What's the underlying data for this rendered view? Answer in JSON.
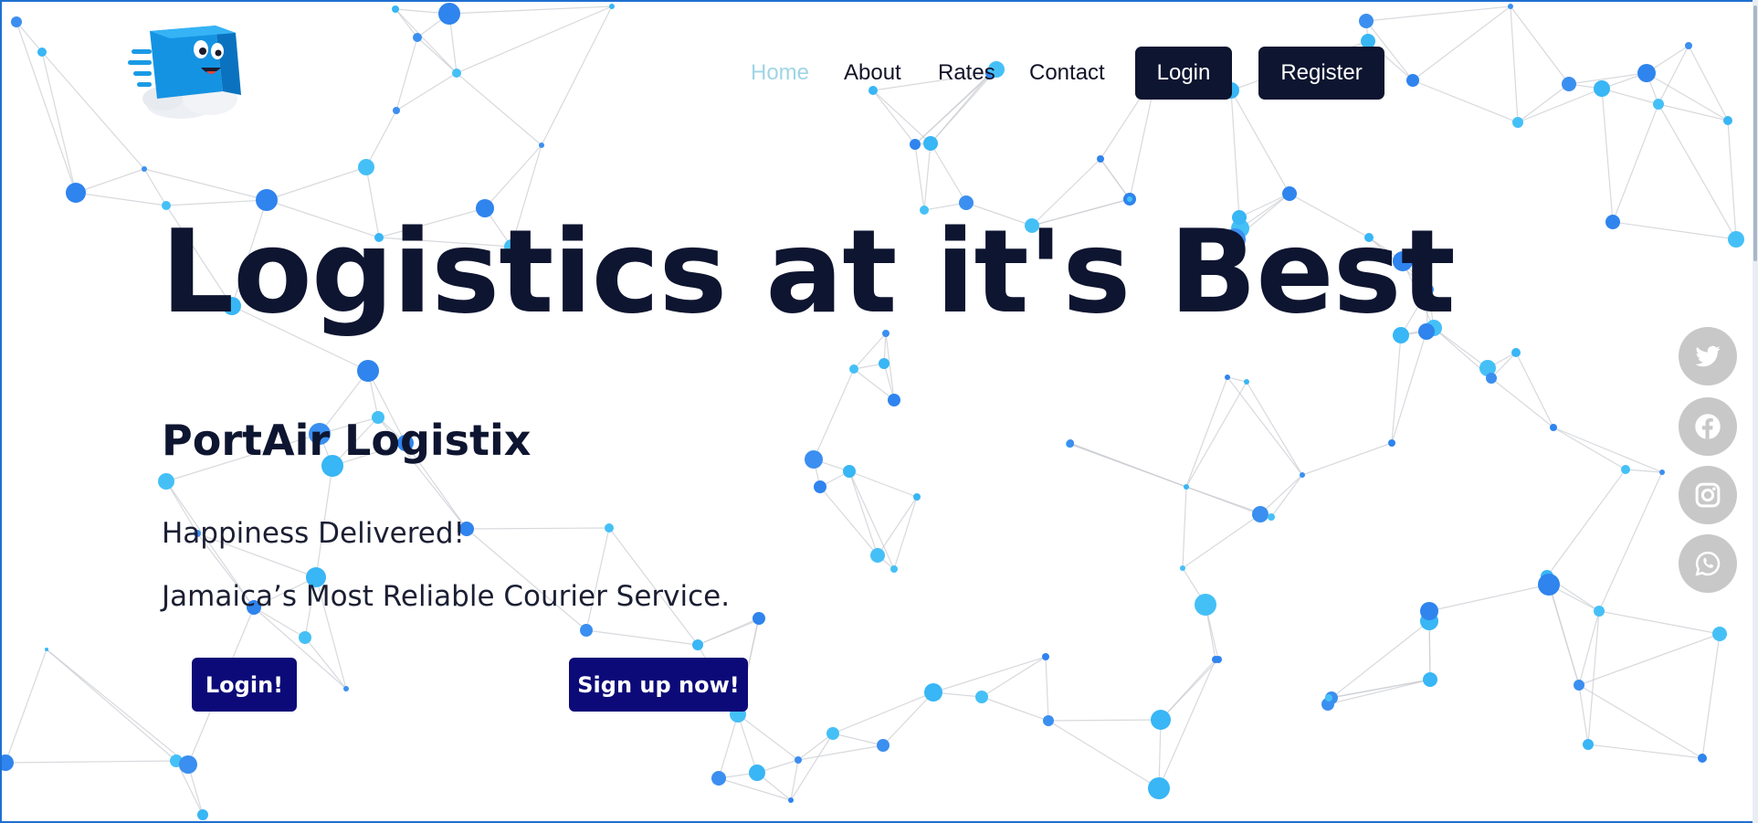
{
  "brand": {
    "logo_icon": "smiling-box-mascot-icon",
    "colors": {
      "navy": "#0e1530",
      "cta": "#0c0a78",
      "active_link": "#9fd5e5",
      "node_blue": "#3b8ff0",
      "node_cyan": "#38b6f5"
    }
  },
  "nav": {
    "links": [
      {
        "label": "Home",
        "active": true
      },
      {
        "label": "About",
        "active": false
      },
      {
        "label": "Rates",
        "active": false
      },
      {
        "label": "Contact",
        "active": false
      }
    ],
    "login_label": "Login",
    "register_label": "Register"
  },
  "hero": {
    "headline": "Logistics at it's Best",
    "company": "PortAir Logistix",
    "tagline1": "Happiness Delivered!",
    "tagline2": "Jamaica’s Most Reliable Courier Service.",
    "login_cta": "Login!",
    "signup_cta": "Sign up now!"
  },
  "social": [
    {
      "icon": "twitter-icon"
    },
    {
      "icon": "facebook-icon"
    },
    {
      "icon": "instagram-icon"
    },
    {
      "icon": "whatsapp-icon"
    }
  ]
}
